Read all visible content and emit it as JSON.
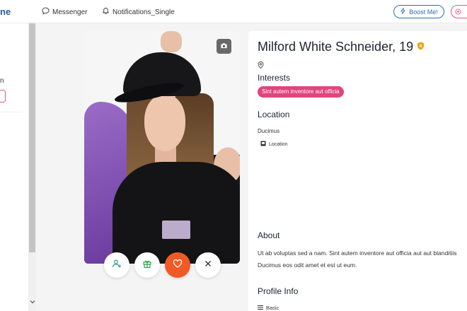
{
  "header": {
    "brand_fragment": "ne",
    "nav": [
      {
        "label": "Messenger",
        "icon": "chat-bubble-icon"
      },
      {
        "label": "Notifications_Single",
        "icon": "bell-icon"
      }
    ],
    "boost_label": "Boost Me!",
    "boost_icon": "lightning-icon"
  },
  "sidebar": {
    "fragment": "n"
  },
  "profile": {
    "name": "Milford White Schneider, 19",
    "verified_icon": "shield-badge-icon",
    "sections": {
      "interests": "Interests",
      "location": "Location",
      "about": "About",
      "profile_info": "Profile Info"
    },
    "interest_tags": [
      "Sint autem inventore aut officia"
    ],
    "location_value": "Ducimus",
    "location_link": "Location",
    "about_text": [
      "Ut ab voluptas sed a nam. Sint autem inventore aut officia aut aut blanditiis",
      "Ducimus eos odit amet et est ut eum."
    ],
    "basic_label": "Basic"
  },
  "colors": {
    "accent_blue": "#2c6db5",
    "tag_pink": "#e0457b",
    "like_orange": "#f15a24",
    "verified_gold": "#e8a317"
  }
}
